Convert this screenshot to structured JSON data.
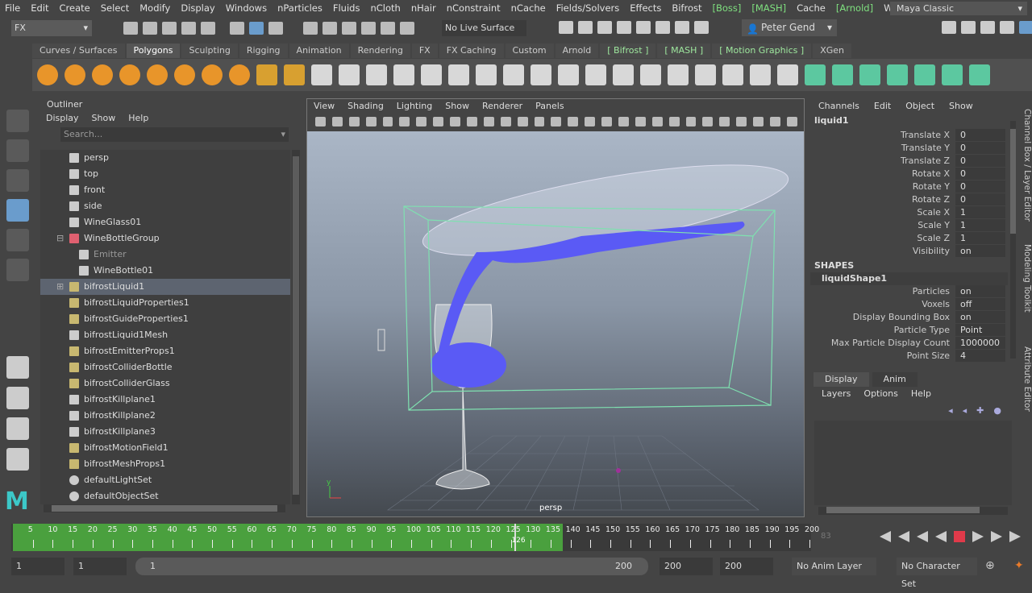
{
  "menubar": {
    "items": [
      "File",
      "Edit",
      "Create",
      "Select",
      "Modify",
      "Display",
      "Windows",
      "nParticles",
      "Fluids",
      "nCloth",
      "nHair",
      "nConstraint",
      "nCache",
      "Fields/Solvers",
      "Effects",
      "Bifrost"
    ],
    "plugin_items": [
      "[Boss]",
      "[MASH]"
    ],
    "cache": "Cache",
    "arnold": "[Arnold]",
    "workspace_label": "Workspace :",
    "workspace_value": "Maya Classic"
  },
  "toolbar": {
    "menuset": "FX",
    "live_surface": "No Live Surface",
    "user": "Peter Gend"
  },
  "shelf": {
    "tabs": [
      "Curves / Surfaces",
      "Polygons",
      "Sculpting",
      "Rigging",
      "Animation",
      "Rendering",
      "FX",
      "FX Caching",
      "Custom",
      "Arnold",
      "[ Bifrost ]",
      "[ MASH ]",
      "[ Motion Graphics ]",
      "XGen"
    ],
    "active": "Polygons"
  },
  "outliner": {
    "title": "Outliner",
    "menu": [
      "Display",
      "Show",
      "Help"
    ],
    "search_placeholder": "Search...",
    "items": [
      {
        "label": "persp",
        "icon": "camera-icon",
        "indent": 0
      },
      {
        "label": "top",
        "icon": "camera-icon",
        "indent": 0
      },
      {
        "label": "front",
        "icon": "camera-icon",
        "indent": 0
      },
      {
        "label": "side",
        "icon": "camera-icon",
        "indent": 0
      },
      {
        "label": "WineGlass01",
        "icon": "mesh-icon",
        "indent": 0
      },
      {
        "label": "WineBottleGroup",
        "icon": "group-icon",
        "indent": 0,
        "expanded": true
      },
      {
        "label": "Emitter",
        "icon": "mesh-icon",
        "indent": 1,
        "dim": true
      },
      {
        "label": "WineBottle01",
        "icon": "mesh-icon",
        "indent": 1
      },
      {
        "label": "bifrostLiquid1",
        "icon": "node-icon",
        "indent": 0,
        "selected": true,
        "collapsed": true
      },
      {
        "label": "bifrostLiquidProperties1",
        "icon": "node-icon",
        "indent": 0
      },
      {
        "label": "bifrostGuideProperties1",
        "icon": "node-icon",
        "indent": 0
      },
      {
        "label": "bifrostLiquid1Mesh",
        "icon": "mesh-icon",
        "indent": 0
      },
      {
        "label": "bifrostEmitterProps1",
        "icon": "node-icon",
        "indent": 0
      },
      {
        "label": "bifrostColliderBottle",
        "icon": "node-icon",
        "indent": 0
      },
      {
        "label": "bifrostColliderGlass",
        "icon": "node-icon",
        "indent": 0
      },
      {
        "label": "bifrostKillplane1",
        "icon": "plane-icon",
        "indent": 0
      },
      {
        "label": "bifrostKillplane2",
        "icon": "plane-icon",
        "indent": 0
      },
      {
        "label": "bifrostKillplane3",
        "icon": "plane-icon",
        "indent": 0
      },
      {
        "label": "bifrostMotionField1",
        "icon": "node-icon",
        "indent": 0
      },
      {
        "label": "bifrostMeshProps1",
        "icon": "node-icon",
        "indent": 0
      },
      {
        "label": "defaultLightSet",
        "icon": "set-icon",
        "indent": 0
      },
      {
        "label": "defaultObjectSet",
        "icon": "set-icon",
        "indent": 0
      }
    ]
  },
  "viewport": {
    "menu": [
      "View",
      "Shading",
      "Lighting",
      "Show",
      "Renderer",
      "Panels"
    ],
    "camera_label": "persp",
    "axis_y": "y",
    "axis_x": "x"
  },
  "channelbox": {
    "menu": [
      "Channels",
      "Edit",
      "Object",
      "Show"
    ],
    "object": "liquid1",
    "channels": [
      {
        "label": "Translate X",
        "value": "0"
      },
      {
        "label": "Translate Y",
        "value": "0"
      },
      {
        "label": "Translate Z",
        "value": "0"
      },
      {
        "label": "Rotate X",
        "value": "0"
      },
      {
        "label": "Rotate Y",
        "value": "0"
      },
      {
        "label": "Rotate Z",
        "value": "0"
      },
      {
        "label": "Scale X",
        "value": "1"
      },
      {
        "label": "Scale Y",
        "value": "1"
      },
      {
        "label": "Scale Z",
        "value": "1"
      },
      {
        "label": "Visibility",
        "value": "on"
      }
    ],
    "shapes_label": "SHAPES",
    "shape": "liquidShape1",
    "shape_channels": [
      {
        "label": "Particles",
        "value": "on"
      },
      {
        "label": "Voxels",
        "value": "off"
      },
      {
        "label": "Display Bounding Box",
        "value": "on"
      },
      {
        "label": "Particle Type",
        "value": "Point"
      },
      {
        "label": "Max Particle Display Count",
        "value": "1000000"
      },
      {
        "label": "Point Size",
        "value": "4"
      }
    ]
  },
  "layer_editor": {
    "tabs": [
      "Display",
      "Anim"
    ],
    "active": "Display",
    "menu": [
      "Layers",
      "Options",
      "Help"
    ]
  },
  "side_tabs": [
    "Channel Box / Layer Editor",
    "Modeling Toolkit",
    "Attribute Editor"
  ],
  "timeline": {
    "ticks": [
      "5",
      "10",
      "15",
      "20",
      "25",
      "30",
      "35",
      "40",
      "45",
      "50",
      "55",
      "60",
      "65",
      "70",
      "75",
      "80",
      "85",
      "90",
      "95",
      "100",
      "105",
      "110",
      "115",
      "120",
      "125",
      "130",
      "135",
      "140",
      "145",
      "150",
      "155",
      "160",
      "165",
      "170",
      "175",
      "180",
      "185",
      "190",
      "195",
      "200"
    ],
    "current_frame": "126",
    "cached_until": 138,
    "max": 200,
    "current_field": "83"
  },
  "range": {
    "start": "1",
    "playback_start": "1",
    "slider_start": "1",
    "slider_end": "200",
    "playback_end": "200",
    "end": "200",
    "anim_layer": "No Anim Layer",
    "character_set": "No Character Set"
  },
  "colors": {
    "cache_green": "#4aa03e",
    "selection": "#5d6470",
    "bbox": "#7fe0b0",
    "liquid": "#5a5af5"
  }
}
